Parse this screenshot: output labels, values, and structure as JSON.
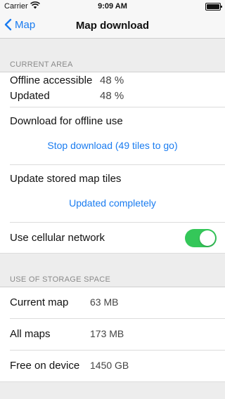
{
  "status_bar": {
    "carrier": "Carrier",
    "time": "9:09 AM"
  },
  "nav": {
    "back_label": "Map",
    "title": "Map download"
  },
  "current_area": {
    "header": "CURRENT AREA",
    "offline_label": "Offline accessible",
    "offline_value": "48 %",
    "updated_label": "Updated",
    "updated_value": "48 %",
    "download_label": "Download for offline use",
    "download_action": "Stop download (49 tiles to go)",
    "update_label": "Update stored map tiles",
    "update_action": "Updated completely",
    "cellular_label": "Use cellular network",
    "cellular_enabled": true
  },
  "storage": {
    "header": "USE OF STORAGE SPACE",
    "rows": [
      {
        "label": "Current map",
        "value": "63 MB"
      },
      {
        "label": "All maps",
        "value": "173 MB"
      },
      {
        "label": "Free on device",
        "value": "1450 GB"
      }
    ]
  },
  "colors": {
    "accent": "#1a7cf0",
    "toggle_on": "#34c759"
  }
}
